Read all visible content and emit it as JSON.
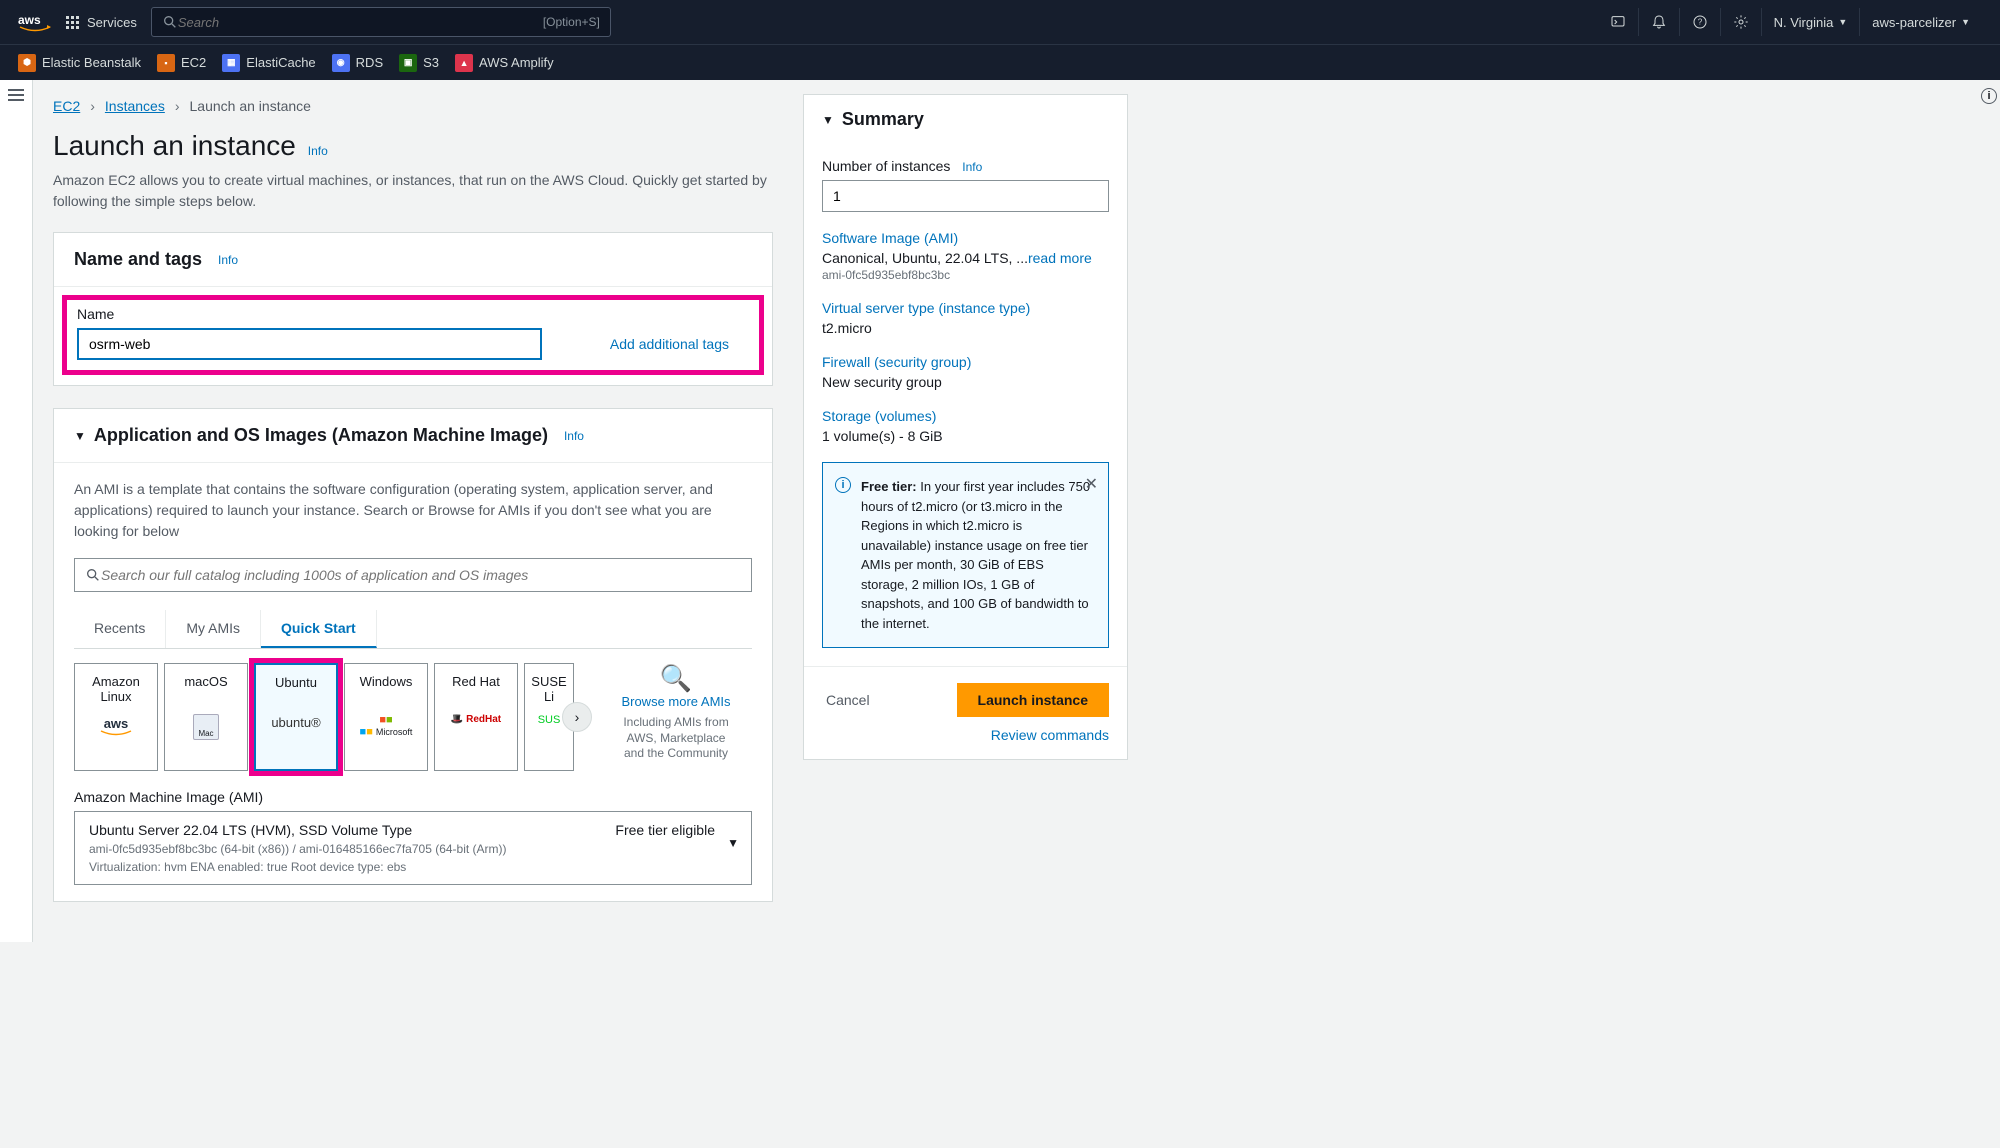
{
  "topnav": {
    "services": "Services",
    "search_placeholder": "Search",
    "shortcut": "[Option+S]",
    "region": "N. Virginia",
    "account": "aws-parcelizer"
  },
  "shortcuts": [
    {
      "label": "Elastic Beanstalk",
      "color": "#d86613"
    },
    {
      "label": "EC2",
      "color": "#d86613"
    },
    {
      "label": "ElastiCache",
      "color": "#4d72f3"
    },
    {
      "label": "RDS",
      "color": "#4d72f3"
    },
    {
      "label": "S3",
      "color": "#1b660f"
    },
    {
      "label": "AWS Amplify",
      "color": "#dd344c"
    }
  ],
  "breadcrumbs": {
    "root": "EC2",
    "parent": "Instances",
    "current": "Launch an instance"
  },
  "header": {
    "title": "Launch an instance",
    "info": "Info",
    "subtitle": "Amazon EC2 allows you to create virtual machines, or instances, that run on the AWS Cloud. Quickly get started by following the simple steps below."
  },
  "name_panel": {
    "title": "Name and tags",
    "info": "Info",
    "name_label": "Name",
    "name_value": "osrm-web",
    "add_tags": "Add additional tags"
  },
  "ami_panel": {
    "title": "Application and OS Images (Amazon Machine Image)",
    "info": "Info",
    "description": "An AMI is a template that contains the software configuration (operating system, application server, and applications) required to launch your instance. Search or Browse for AMIs if you don't see what you are looking for below",
    "search_placeholder": "Search our full catalog including 1000s of application and OS images",
    "tabs": {
      "recents": "Recents",
      "my_amis": "My AMIs",
      "quick_start": "Quick Start"
    },
    "os_cards": [
      {
        "name": "Amazon Linux",
        "logo": "aws"
      },
      {
        "name": "macOS",
        "logo": "Mac"
      },
      {
        "name": "Ubuntu",
        "logo": "ubuntu®"
      },
      {
        "name": "Windows",
        "logo": "Microsoft"
      },
      {
        "name": "Red Hat",
        "logo": "RedHat"
      },
      {
        "name": "SUSE Li",
        "logo": "SUS"
      }
    ],
    "browse_more": "Browse more AMIs",
    "browse_sub": "Including AMIs from AWS, Marketplace and the Community",
    "ami_label": "Amazon Machine Image (AMI)",
    "selected_ami": {
      "title": "Ubuntu Server 22.04 LTS (HVM), SSD Volume Type",
      "meta1": "ami-0fc5d935ebf8bc3bc (64-bit (x86)) / ami-016485166ec7fa705 (64-bit (Arm))",
      "meta2": "Virtualization: hvm    ENA enabled: true    Root device type: ebs",
      "free_tier": "Free tier eligible"
    }
  },
  "summary": {
    "title": "Summary",
    "num_instances_label": "Number of instances",
    "info": "Info",
    "num_instances_value": "1",
    "software_image_title": "Software Image (AMI)",
    "software_image_value": "Canonical, Ubuntu, 22.04 LTS, ...",
    "read_more": "read more",
    "software_image_id": "ami-0fc5d935ebf8bc3bc",
    "instance_type_title": "Virtual server type (instance type)",
    "instance_type_value": "t2.micro",
    "firewall_title": "Firewall (security group)",
    "firewall_value": "New security group",
    "storage_title": "Storage (volumes)",
    "storage_value": "1 volume(s) - 8 GiB",
    "free_tier_label": "Free tier:",
    "free_tier_text": " In your first year includes 750 hours of t2.micro (or t3.micro in the Regions in which t2.micro is unavailable) instance usage on free tier AMIs per month, 30 GiB of EBS storage, 2 million IOs, 1 GB of snapshots, and 100 GB of bandwidth to the internet.",
    "cancel": "Cancel",
    "launch": "Launch instance",
    "review": "Review commands"
  }
}
